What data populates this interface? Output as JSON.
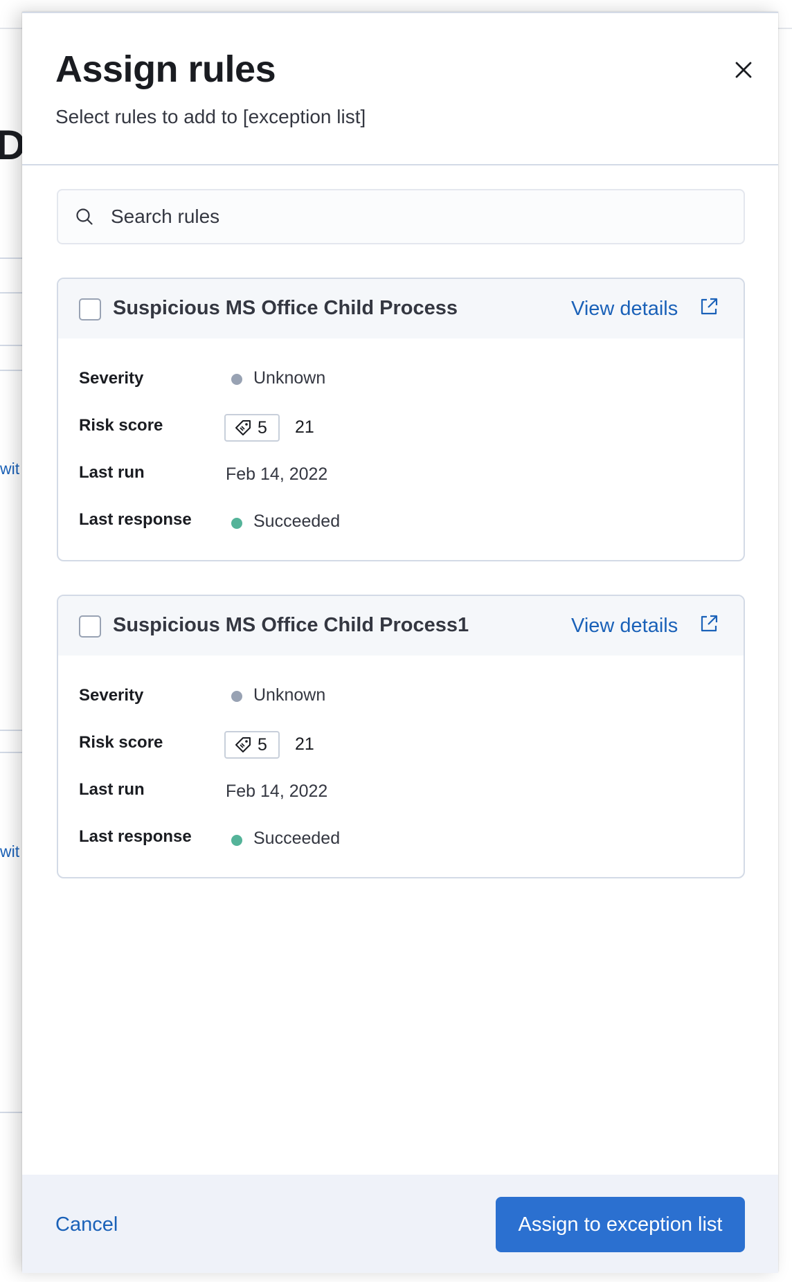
{
  "background": {
    "title_fragment": "Do",
    "link_fragment": "wit"
  },
  "flyout": {
    "title": "Assign rules",
    "subtitle": "Select rules to add to [exception list]"
  },
  "search": {
    "placeholder": "Search rules",
    "value": ""
  },
  "labels": {
    "severity": "Severity",
    "risk_score": "Risk score",
    "last_run": "Last run",
    "last_response": "Last response",
    "view_details": "View details"
  },
  "rules": [
    {
      "name": "Suspicious MS Office Child Process",
      "severity": "Unknown",
      "severity_color": "#98a2b3",
      "risk_badge": "5",
      "risk_score": "21",
      "last_run": "Feb 14, 2022",
      "last_response": "Succeeded",
      "last_response_color": "#54b399",
      "checked": false
    },
    {
      "name": "Suspicious MS Office Child Process1",
      "severity": "Unknown",
      "severity_color": "#98a2b3",
      "risk_badge": "5",
      "risk_score": "21",
      "last_run": "Feb 14, 2022",
      "last_response": "Succeeded",
      "last_response_color": "#54b399",
      "checked": false
    }
  ],
  "footer": {
    "cancel_label": "Cancel",
    "assign_label": "Assign to exception list"
  },
  "colors": {
    "link": "#1a61b8",
    "primary": "#2b70d0"
  }
}
